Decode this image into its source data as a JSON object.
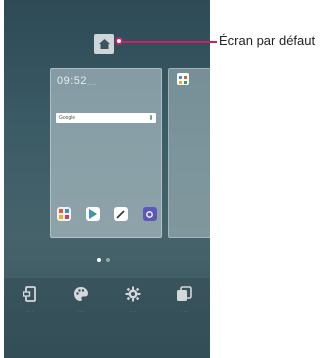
{
  "callout": {
    "label": "Écran par défaut"
  },
  "icons": {
    "home": "home-icon",
    "widgets": "widgets-icon",
    "themes": "palette-icon",
    "settings": "gear-icon",
    "wallpaper": "wallpaper-icon"
  },
  "colors": {
    "accent": "#c5226a",
    "wallpaper_top": "#2d4a55",
    "wallpaper_mid": "#46636b"
  },
  "page_indicator": {
    "count": 2,
    "current": 1
  }
}
